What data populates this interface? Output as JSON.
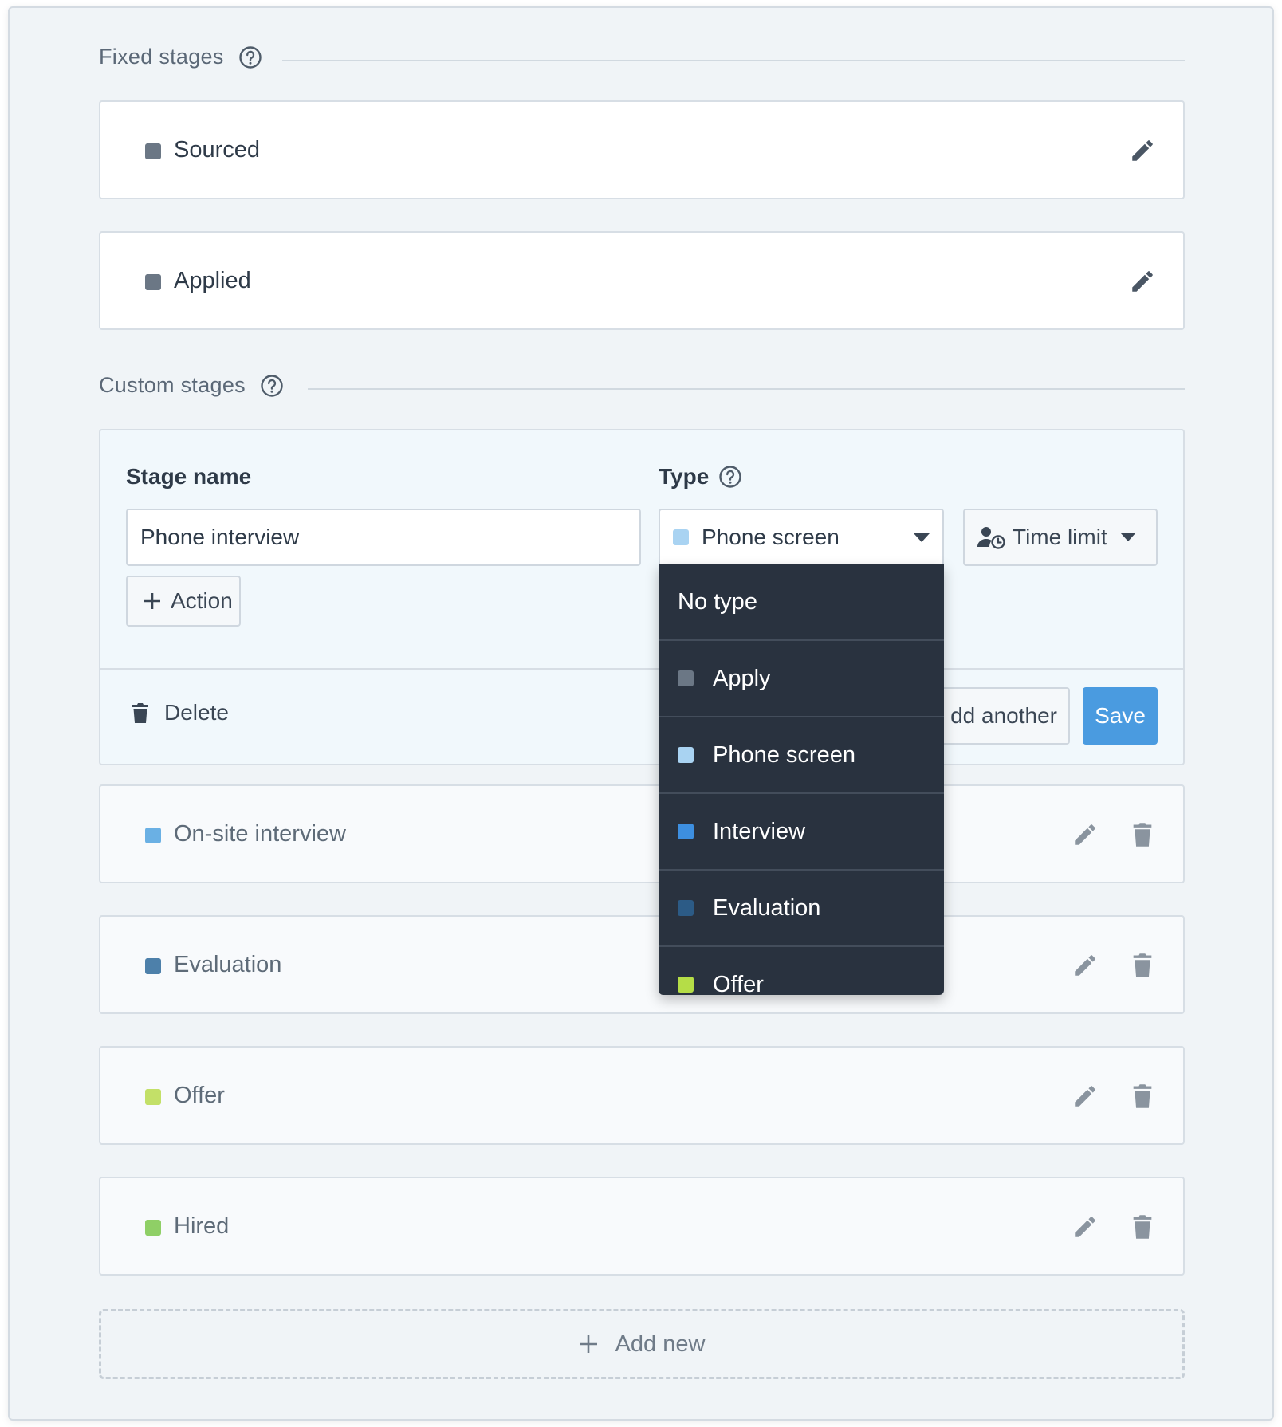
{
  "fixed_section": {
    "title": "Fixed stages",
    "help_icon": "help-circle-icon"
  },
  "fixed_stages": [
    {
      "label": "Sourced",
      "color": "#6b7785",
      "icon": "pencil-icon"
    },
    {
      "label": "Applied",
      "color": "#6b7785",
      "icon": "pencil-icon"
    }
  ],
  "custom_section": {
    "title": "Custom stages",
    "help_icon": "help-circle-icon"
  },
  "editor": {
    "stage_name_label": "Stage name",
    "stage_name_value": "Phone interview",
    "type_label": "Type",
    "type_selected": "Phone screen",
    "type_selected_color": "#a9d3f2",
    "time_limit_label": "Time limit",
    "action_label": "Action",
    "delete_label": "Delete",
    "add_another_label": "dd another",
    "save_label": "Save"
  },
  "type_options": [
    {
      "label": "No type",
      "color": ""
    },
    {
      "label": "Apply",
      "color": "#6b7785"
    },
    {
      "label": "Phone screen",
      "color": "#a9d3f2"
    },
    {
      "label": "Interview",
      "color": "#3d8fe0"
    },
    {
      "label": "Evaluation",
      "color": "#2c5b86"
    },
    {
      "label": "Offer",
      "color": "#b5dd47"
    }
  ],
  "custom_stages": [
    {
      "label": "On-site interview",
      "color": "#6ab0e4"
    },
    {
      "label": "Evaluation",
      "color": "#4d80aa"
    },
    {
      "label": "Offer",
      "color": "#c3e068"
    },
    {
      "label": "Hired",
      "color": "#8fcf66"
    }
  ],
  "add_new_label": "Add new",
  "colors": {
    "accent": "#4a9be0",
    "menu_bg": "#29323f"
  }
}
